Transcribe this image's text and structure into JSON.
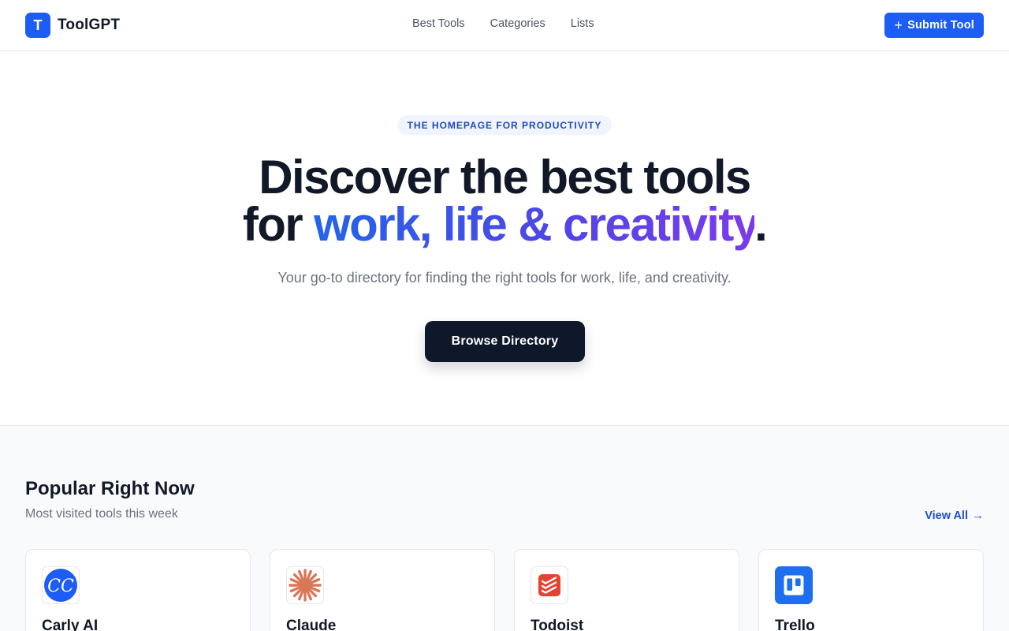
{
  "header": {
    "logo_letter": "T",
    "brand": "ToolGPT",
    "nav": [
      "Best Tools",
      "Categories",
      "Lists"
    ],
    "submit_label": "Submit Tool"
  },
  "hero": {
    "badge": "THE HOMEPAGE FOR PRODUCTIVITY",
    "headline_line1": "Discover the best tools",
    "headline_for": "for ",
    "headline_highlight": "work, life & creativity",
    "headline_period": ".",
    "subtitle": "Your go-to directory for finding the right tools for work, life, and creativity.",
    "cta": "Browse Directory"
  },
  "popular": {
    "title": "Popular Right Now",
    "subtitle": "Most visited tools this week",
    "view_all": "View All",
    "tools": [
      {
        "name": "Carly AI",
        "icon": "carly-ai-logo-icon",
        "color": "#1d5cf5"
      },
      {
        "name": "Claude",
        "icon": "claude-logo-icon",
        "color": "#d97757"
      },
      {
        "name": "Todoist",
        "icon": "todoist-logo-icon",
        "color": "#e44332"
      },
      {
        "name": "Trello",
        "icon": "trello-logo-icon",
        "color": "#1d6ff0"
      }
    ]
  },
  "colors": {
    "accent": "#1d5cf5",
    "dark": "#0f172a",
    "gradient_start": "#2563eb",
    "gradient_end": "#7c3aed"
  }
}
